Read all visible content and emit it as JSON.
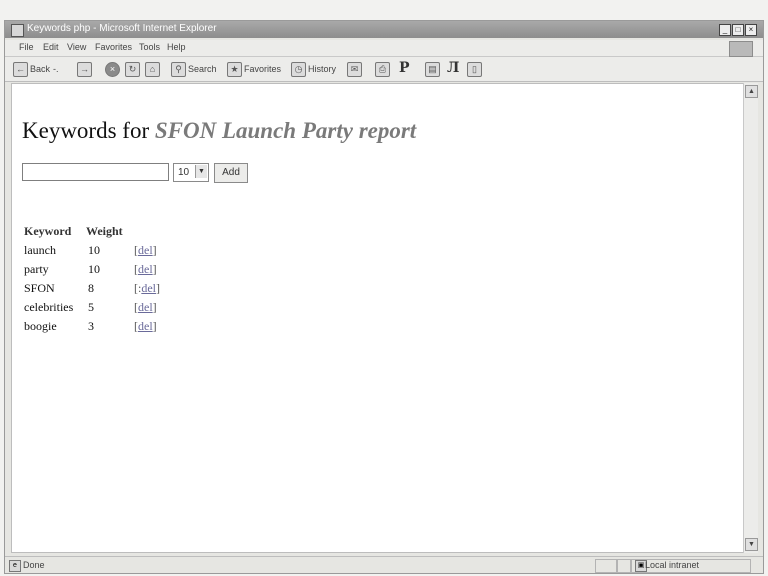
{
  "window": {
    "title": "Keywords php - Microsoft Internet Explorer",
    "controls": [
      "_",
      "□",
      "×"
    ]
  },
  "menu": {
    "items": [
      "File",
      "Edit",
      "View",
      "Favorites",
      "Tools",
      "Help"
    ]
  },
  "toolbar": {
    "back_label": "Back",
    "back_sep": "-.",
    "search_label": "Search",
    "favorites_label": "Favorites",
    "history_label": "History",
    "glyph_p": "P",
    "glyph_pi": "Л"
  },
  "page": {
    "heading_prefix": "Keywords for",
    "report_name": "SFON Launch Party report",
    "keyword_input_value": "",
    "weight_selected": "10",
    "add_label": "Add",
    "table": {
      "headers": [
        "Keyword",
        "Weight"
      ],
      "rows": [
        {
          "keyword": "launch",
          "weight": "10",
          "del_open": "[",
          "del_label": "del",
          "del_close": "]"
        },
        {
          "keyword": "party",
          "weight": "10",
          "del_open": "[",
          "del_label": "del",
          "del_close": "]"
        },
        {
          "keyword": "SFON",
          "weight": "8",
          "del_open": "[:",
          "del_label": "del",
          "del_close": "]"
        },
        {
          "keyword": "celebrities",
          "weight": "5",
          "del_open": "[",
          "del_label": "del",
          "del_close": "]"
        },
        {
          "keyword": "boogie",
          "weight": "3",
          "del_open": "[",
          "del_label": "del",
          "del_close": "]"
        }
      ]
    }
  },
  "status": {
    "text": "Done",
    "zone": "Local intranet"
  },
  "icons": [
    "ie-page-icon",
    "back-icon",
    "forward-icon",
    "stop-icon",
    "refresh-icon",
    "home-icon",
    "search-icon",
    "favorites-icon",
    "history-icon",
    "mail-icon",
    "print-icon",
    "edit-icon",
    "discuss-icon",
    "intranet-icon"
  ]
}
